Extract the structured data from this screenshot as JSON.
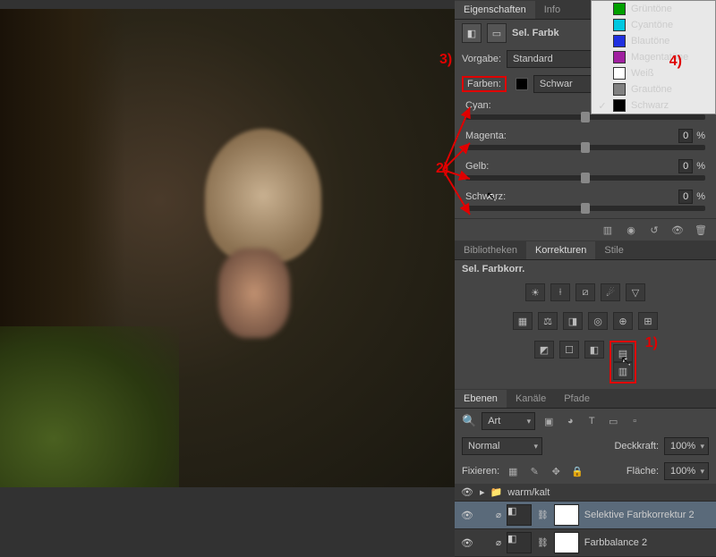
{
  "tabs": {
    "properties": "Eigenschaften",
    "info": "Info"
  },
  "panel_title": "Sel. Farbk",
  "preset": {
    "label": "Vorgabe:",
    "value": "Standard"
  },
  "colors": {
    "label": "Farben:",
    "value": "Schwar"
  },
  "color_menu": [
    {
      "name": "Grüntöne",
      "hex": "#00a000",
      "checked": false
    },
    {
      "name": "Cyantöne",
      "hex": "#00c8e0",
      "checked": false
    },
    {
      "name": "Blautöne",
      "hex": "#2030e0",
      "checked": false
    },
    {
      "name": "Magentatöne",
      "hex": "#a020a0",
      "checked": false
    },
    {
      "name": "Weiß",
      "hex": "#ffffff",
      "checked": false
    },
    {
      "name": "Grautöne",
      "hex": "#808080",
      "checked": false
    },
    {
      "name": "Schwarz",
      "hex": "#000000",
      "checked": true
    }
  ],
  "sliders": [
    {
      "label": "Cyan:",
      "value": "0"
    },
    {
      "label": "Magenta:",
      "value": "0"
    },
    {
      "label": "Gelb:",
      "value": "0"
    },
    {
      "label": "Schwarz:",
      "value": "0"
    }
  ],
  "lib_tabs": {
    "bibliotheken": "Bibliotheken",
    "korrekturen": "Korrekturen",
    "stile": "Stile"
  },
  "adj_title": "Sel. Farbkorr.",
  "layer_tabs": {
    "ebenen": "Ebenen",
    "kanale": "Kanäle",
    "pfade": "Pfade"
  },
  "filter": {
    "label": "Art",
    "icons": [
      "▣",
      "◕",
      "T",
      "▭",
      "▫"
    ]
  },
  "blend": {
    "value": "Normal",
    "opacity_label": "Deckkraft:",
    "opacity": "100%"
  },
  "lock": {
    "label": "Fixieren:",
    "fill_label": "Fläche:",
    "fill": "100%"
  },
  "layers": [
    {
      "name": "warm/kalt",
      "group": true
    },
    {
      "name": "Selektive Farbkorrektur 2",
      "selected": true
    },
    {
      "name": "Farbbalance 2",
      "selected": false
    }
  ],
  "annotations": {
    "a1": "1)",
    "a2": "2)",
    "a3": "3)",
    "a4": "4)"
  }
}
